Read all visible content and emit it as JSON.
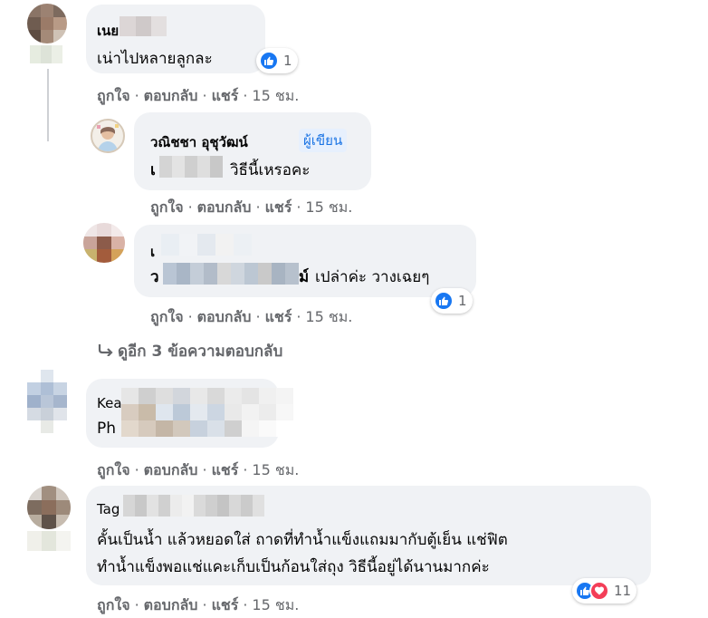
{
  "comments": [
    {
      "name": "เนย เนย",
      "text": "เน่าไปหลายลูกละ",
      "reactions": {
        "count": "1"
      },
      "actions": {
        "like": "ถูกใจ",
        "reply": "ตอบกลับ",
        "share": "แชร์",
        "time": "15 ชม."
      }
    },
    {
      "name": "วณิชชา อุชุวัฒน์",
      "badge": "ผู้เขียน",
      "text_prefix": "เ",
      "text": "วิธีนี้เหรอคะ",
      "actions": {
        "like": "ถูกใจ",
        "reply": "ตอบกลับ",
        "share": "แชร์",
        "time": "15 ชม."
      }
    },
    {
      "name": "เ",
      "text_prefix": "ว",
      "text_suffix": "ม์",
      "text": "เปล่าค่ะ วางเฉยๆ",
      "reactions": {
        "count": "1"
      },
      "actions": {
        "like": "ถูกใจ",
        "reply": "ตอบกลับ",
        "share": "แชร์",
        "time": "15 ชม."
      }
    },
    {
      "name": "Kea",
      "text": "Ph",
      "actions": {
        "like": "ถูกใจ",
        "reply": "ตอบกลับ",
        "share": "แชร์",
        "time": "15 ชม."
      }
    },
    {
      "name": "Tag",
      "text_line1": "คั้นเป็นน้ำ แล้วหยอดใส่ ถาดที่ทำน้ำแข็งแถมมากับตู้เย็น แช่ฟิต",
      "text_line2": "ทำน้ำแข็งพอแช่แคะเก็บเป็นก้อนใส่ถุง วิธีนี้อยู่ได้นานมากค่ะ",
      "reactions": {
        "count": "11"
      },
      "actions": {
        "like": "ถูกใจ",
        "reply": "ตอบกลับ",
        "share": "แชร์",
        "time": "15 ชม."
      }
    }
  ],
  "view_more": "ดูอีก 3 ข้อความตอบกลับ",
  "separator": "·",
  "icons": {
    "like": "thumbs-up-icon",
    "love": "heart-icon",
    "reply_arrow": "reply-arrow-icon"
  },
  "colors": {
    "like_blue": "#1877f2",
    "love_red": "#f33e58",
    "bubble": "#f0f2f5",
    "muted": "#65676b",
    "author_blue": "#1b74e4"
  }
}
